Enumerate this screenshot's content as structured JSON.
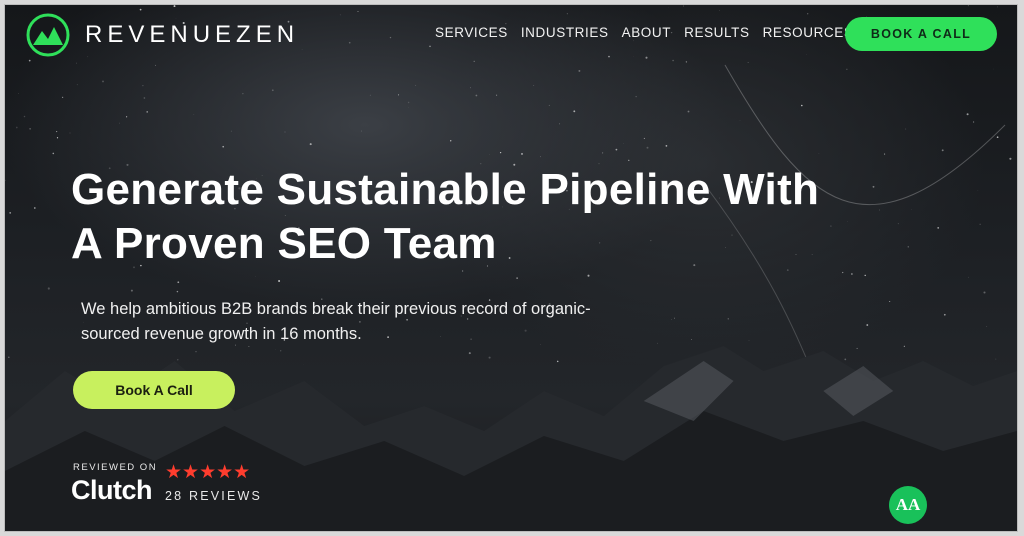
{
  "brand": {
    "name": "REVENUEZEN",
    "accent": "#2fe05a"
  },
  "nav": {
    "items": [
      "SERVICES",
      "INDUSTRIES",
      "ABOUT",
      "RESULTS",
      "RESOURCES"
    ],
    "cta": "BOOK A CALL"
  },
  "hero": {
    "headline_line1": "Generate Sustainable Pipeline With",
    "headline_line2": "A Proven SEO Team",
    "subtext_line1": "We help ambitious B2B brands break their previous record of organic-",
    "subtext_line2": "sourced revenue growth in 16 months.",
    "cta": "Book A Call",
    "cta_color": "#c8f05e"
  },
  "reviews": {
    "reviewed_on": "REVIEWED ON",
    "platform": "Clutch",
    "stars": "★★★★★",
    "rating": 5,
    "count_text": "28 REVIEWS",
    "star_color": "#ff3d2e"
  },
  "accessibility_badge": {
    "label": "AA",
    "icon": "accessibility-icon"
  }
}
